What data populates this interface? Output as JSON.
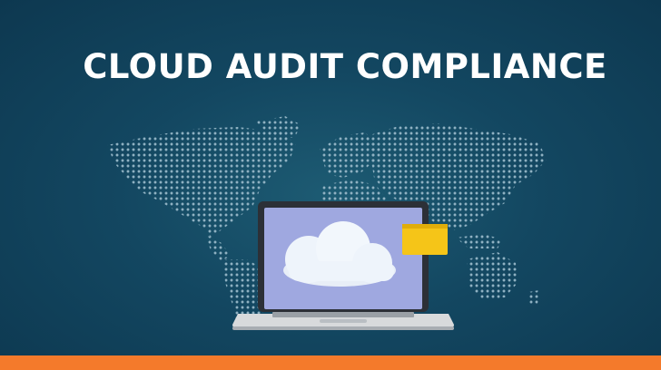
{
  "banner": {
    "title": "CLOUD AUDIT COMPLIANCE",
    "colors": {
      "background": "#134761",
      "title_text": "#ffffff",
      "map_dots": "#8fb1c2",
      "laptop_screen": "#9fa8e0",
      "laptop_body": "#d8dadc",
      "cloud": "#eef4fb",
      "folder": "#f5c518",
      "accent_bar": "#f47a2b"
    },
    "icons": [
      "world-map-icon",
      "laptop-icon",
      "cloud-icon",
      "folder-icon"
    ]
  }
}
